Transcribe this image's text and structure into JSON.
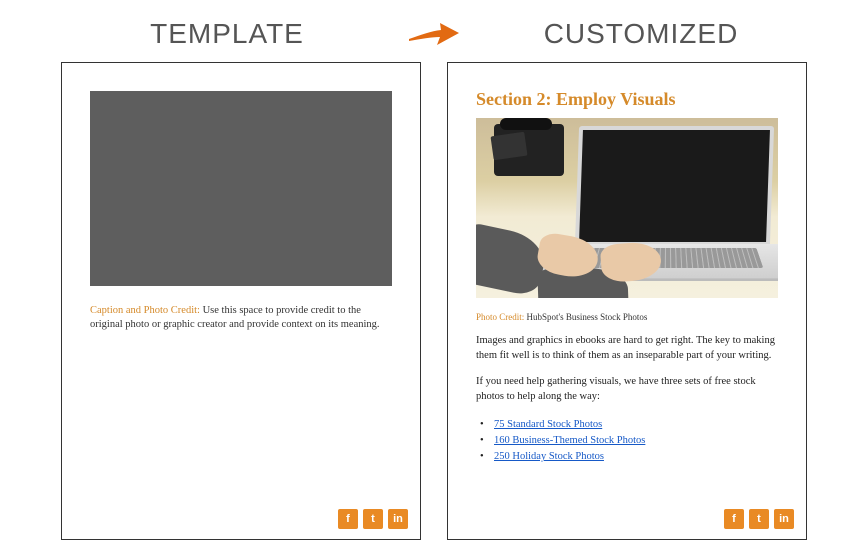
{
  "header": {
    "left_label": "TEMPLATE",
    "right_label": "CUSTOMIZED"
  },
  "template_page": {
    "caption_label": "Caption and Photo Credit:",
    "caption_text": " Use this space to provide credit to the original photo or graphic creator and provide context on its meaning."
  },
  "customized_page": {
    "section_title": "Section 2: Employ Visuals",
    "photo_credit_label": "Photo Credit:",
    "photo_credit_text": " HubSpot's Business Stock Photos",
    "paragraph_1": "Images and graphics in ebooks are hard to get right. The key to making them fit well is to think of them as an inseparable part of your writing.",
    "paragraph_2": "If you need help gathering visuals, we have three sets of free stock photos to help along the way:",
    "links": [
      "75 Standard Stock Photos",
      "160 Business-Themed Stock Photos",
      "250 Holiday Stock Photos"
    ]
  },
  "social": {
    "facebook": "f",
    "tumblr": "t",
    "linkedin": "in"
  },
  "colors": {
    "accent_orange": "#e98a24",
    "heading_orange": "#d58a2a",
    "link_blue": "#1659c7"
  }
}
